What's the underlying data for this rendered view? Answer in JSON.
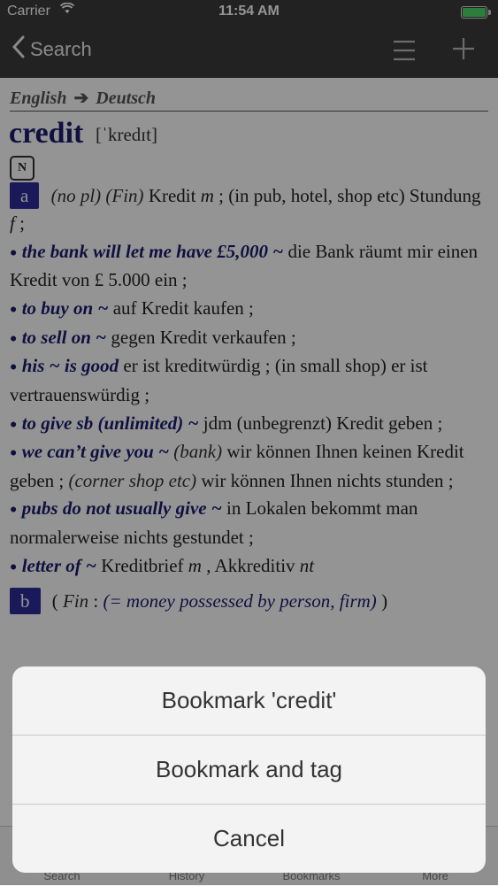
{
  "status": {
    "carrier": "Carrier",
    "time": "11:54 AM"
  },
  "nav": {
    "back_label": "Search",
    "icons": [
      "chevron-left-icon",
      "menu-icon",
      "plus-icon"
    ]
  },
  "dict": {
    "lang_from": "English",
    "lang_to": "Deutsch",
    "headword": "credit",
    "pronunciation": "[ˈkredɪt]",
    "pos": "N",
    "sense_a": {
      "label": "a",
      "gloss1": "(no pl)",
      "gloss2": "(Fin)",
      "text1": "Kredit",
      "gender1": "m",
      "text2": "; (in pub, hotel, shop etc) Stundung",
      "gender2": "f",
      "text3": ";"
    },
    "examples": [
      {
        "phrase": "the bank will let me have £5,000 ~",
        "translation": "die Bank räumt mir einen Kredit von £ 5.000 ein ;"
      },
      {
        "phrase": "to buy on ~",
        "translation": "auf Kredit kaufen ;"
      },
      {
        "phrase": "to sell on ~",
        "translation": "gegen Kredit verkaufen ;"
      },
      {
        "phrase": "his ~ is good",
        "translation": "er ist kreditwürdig ; (in small shop) er ist vertrauenswürdig ;"
      },
      {
        "phrase": "to give sb (unlimited) ~",
        "translation": "jdm (unbegrenzt) Kredit geben ;"
      },
      {
        "phrase": "we can’t give you ~",
        "gloss": "(bank)",
        "translation": "wir können Ihnen keinen Kredit geben ;",
        "gloss2": "(corner shop etc)",
        "translation2": "wir können Ihnen nichts stunden ;"
      },
      {
        "phrase": "pubs do not usually give ~",
        "translation": "in Lokalen bekommt man normalerweise nichts gestundet ;"
      },
      {
        "phrase": "letter of ~",
        "translation": "Kreditbrief",
        "gender": "m",
        "translation2": ", Akkreditiv",
        "gender2": "nt"
      }
    ],
    "sense_b": {
      "label": "b",
      "open": "(",
      "gloss_a": "Fin",
      "colon": ":",
      "gloss_b": "(= money possessed by person, firm)",
      "close": ")"
    }
  },
  "tabs": [
    "Search",
    "History",
    "Bookmarks",
    "More"
  ],
  "sheet": {
    "options": [
      "Bookmark 'credit'",
      "Bookmark and tag",
      "Cancel"
    ]
  },
  "colors": {
    "accent": "#2e2e9c",
    "headword": "#1c1c6e",
    "bar": "#3c3c3c",
    "battery": "#4cd964"
  }
}
